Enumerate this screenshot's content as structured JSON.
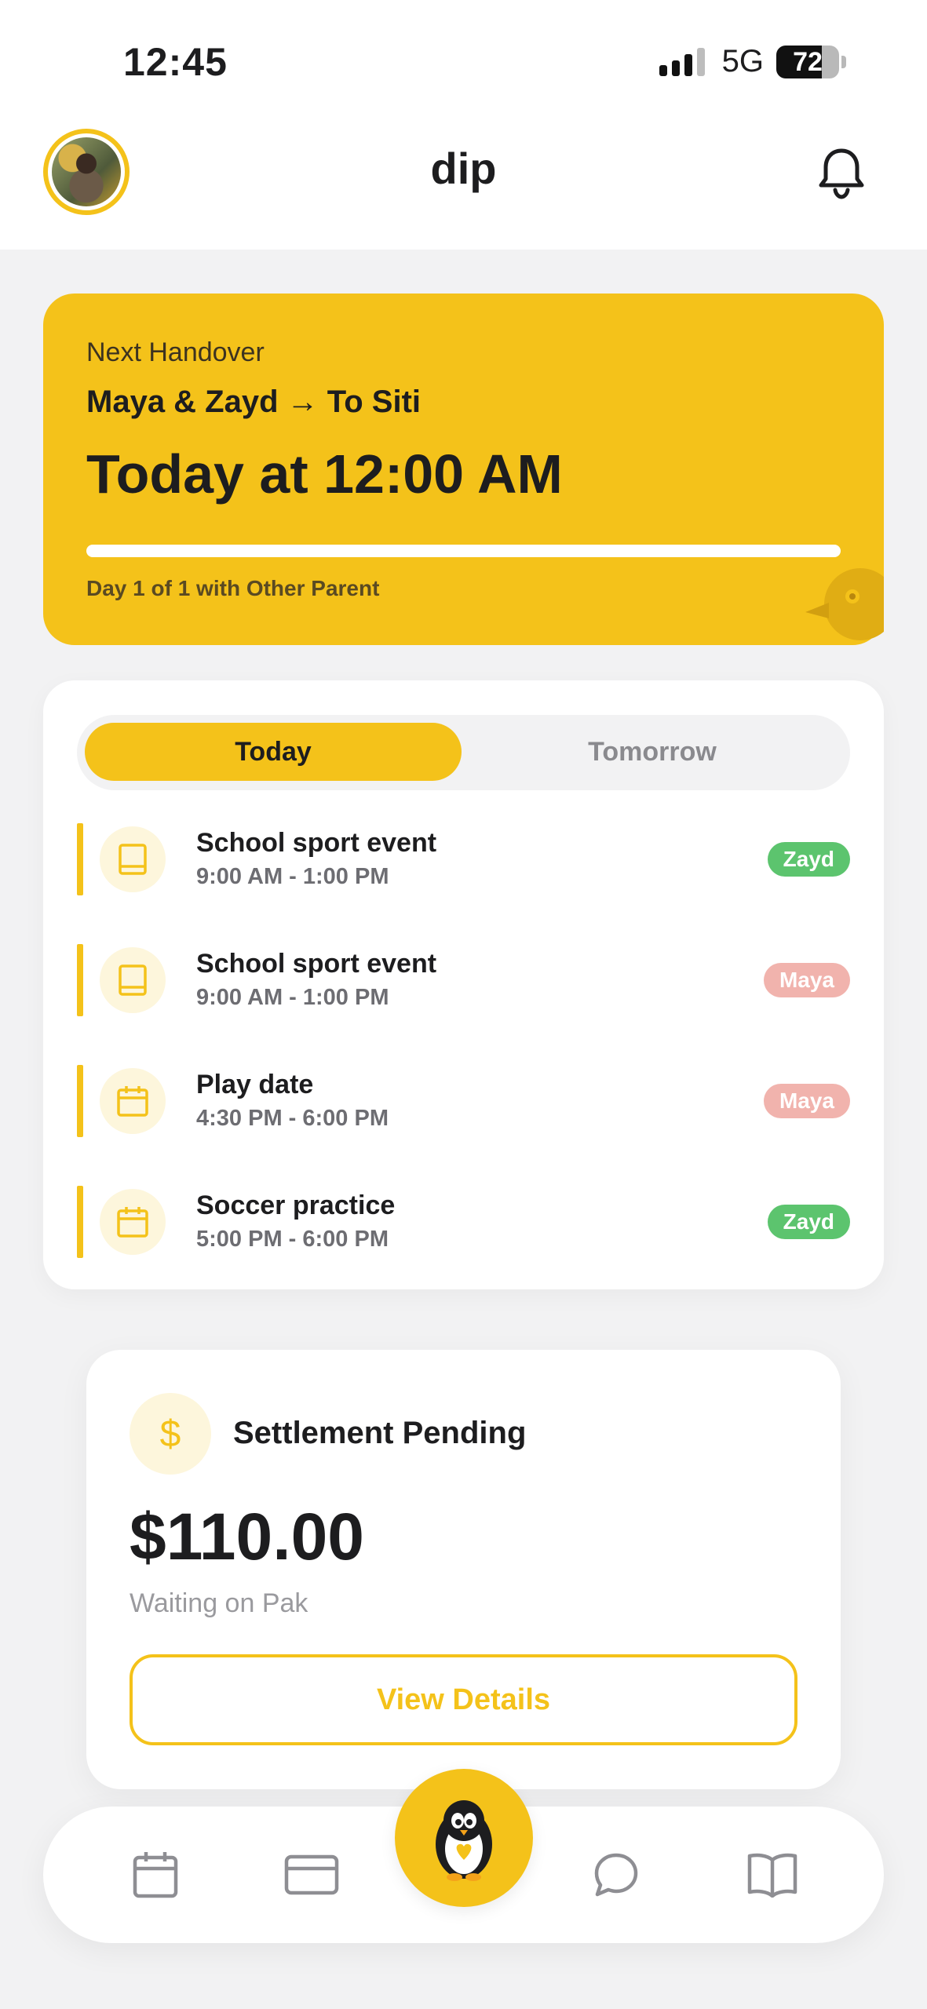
{
  "status_bar": {
    "time": "12:45",
    "network": "5G",
    "battery": "72"
  },
  "header": {
    "title": "dip",
    "avatar_icon": "profile-photo",
    "bell_icon": "bell-icon"
  },
  "handover": {
    "label": "Next Handover",
    "route": "Maya & Zayd → To Siti",
    "when": "Today at 12:00 AM",
    "progress": 1.0,
    "day_text": "Day 1 of 1 with Other Parent"
  },
  "schedule": {
    "tabs": [
      {
        "label": "Today",
        "active": true
      },
      {
        "label": "Tomorrow",
        "active": false
      }
    ],
    "events": [
      {
        "title": "School sport event",
        "time": "9:00 AM - 1:00 PM",
        "child": "Zayd",
        "icon": "book-icon",
        "tag_color": "#5cc46e"
      },
      {
        "title": "School sport event",
        "time": "9:00 AM - 1:00 PM",
        "child": "Maya",
        "icon": "book-icon",
        "tag_color": "#f1b3ad"
      },
      {
        "title": "Play date",
        "time": "4:30 PM - 6:00 PM",
        "child": "Maya",
        "icon": "calendar-icon",
        "tag_color": "#f1b3ad"
      },
      {
        "title": "Soccer practice",
        "time": "5:00 PM - 6:00 PM",
        "child": "Zayd",
        "icon": "calendar-icon",
        "tag_color": "#5cc46e"
      }
    ]
  },
  "settlement": {
    "title": "Settlement Pending",
    "amount": "$110.00",
    "status": "Waiting on Pak",
    "button": "View Details",
    "icon": "dollar-icon"
  },
  "bottom_nav": {
    "items": [
      "calendar-icon",
      "card-icon",
      "penguin-icon",
      "chat-icon",
      "book-icon"
    ]
  },
  "colors": {
    "accent": "#f4c21a",
    "accent_soft": "#fdf6dc",
    "green_tag": "#5cc46e",
    "pink_tag": "#f1b3ad",
    "background": "#f2f2f3"
  }
}
